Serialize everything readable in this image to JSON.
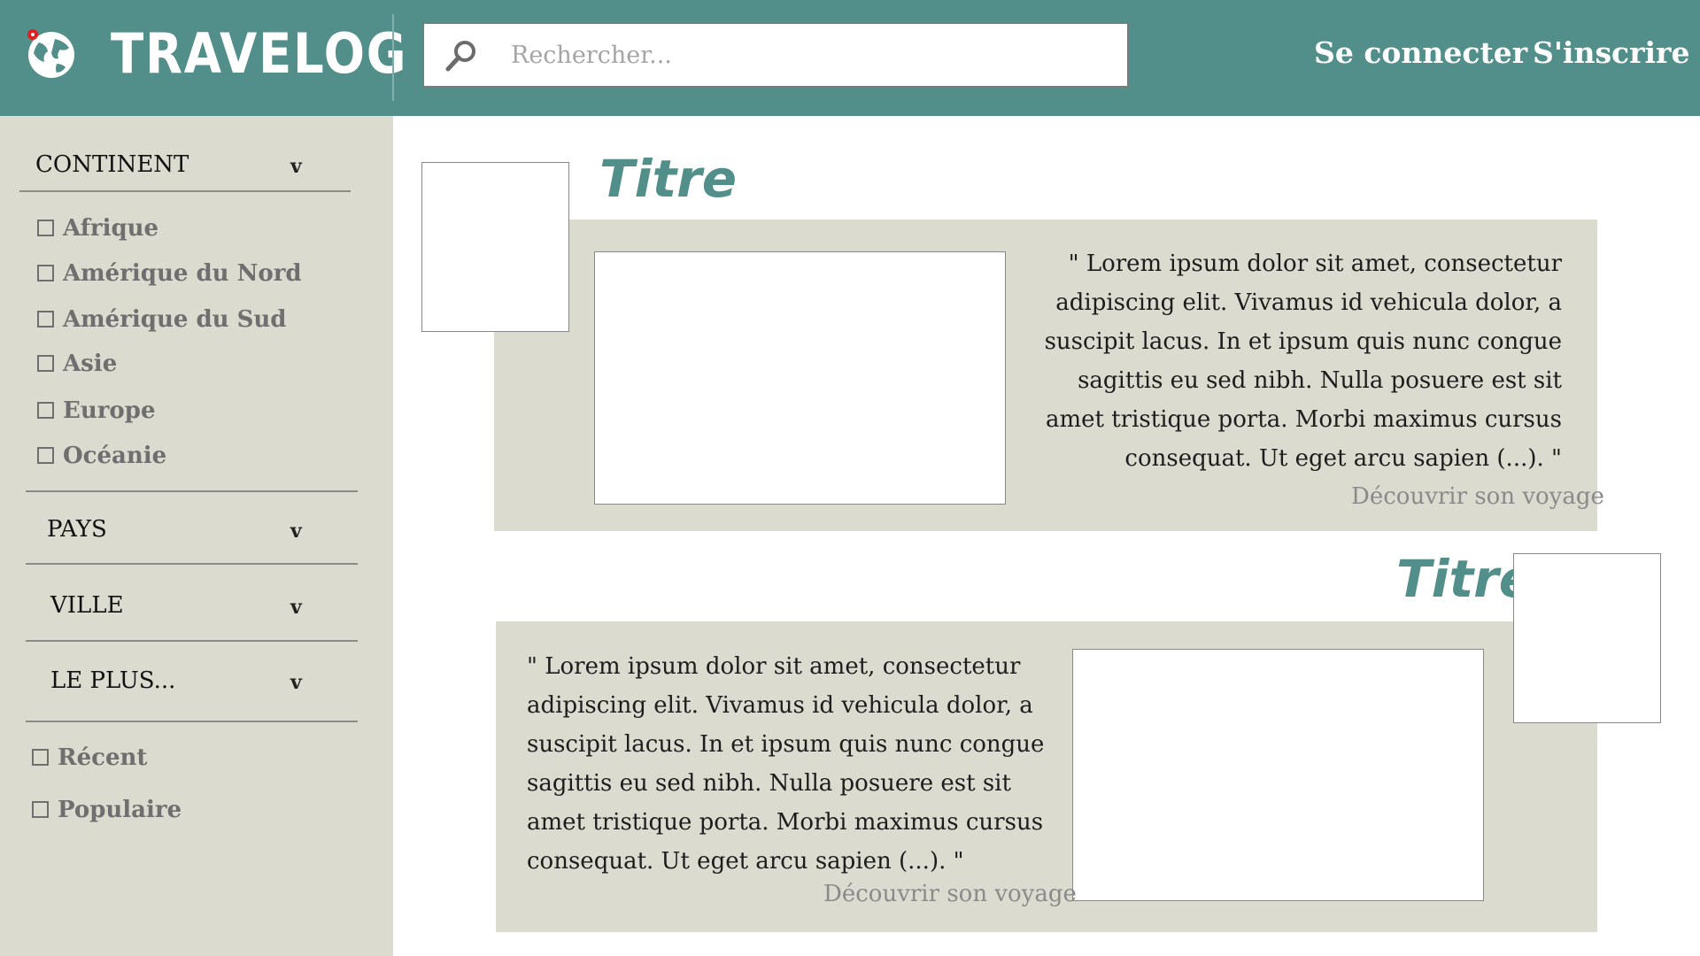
{
  "header": {
    "brand": "TRAVELOG",
    "search_placeholder": "Rechercher...",
    "login_label": "Se connecter",
    "signup_label": "S'inscrire",
    "colors": {
      "bar": "#538f8a",
      "text": "#ffffff",
      "pin": "#e02020"
    },
    "icons": {
      "logo": "globe-pin-icon",
      "search": "magnifier-icon"
    }
  },
  "sidebar": {
    "continent": {
      "label": "CONTINENT",
      "chevron": "v",
      "options": [
        "Afrique",
        "Amérique du Nord",
        "Amérique du Sud",
        "Asie",
        "Europe",
        "Océanie"
      ]
    },
    "pays": {
      "label": "PAYS",
      "chevron": "v"
    },
    "ville": {
      "label": "VILLE",
      "chevron": "v"
    },
    "le_plus": {
      "label": "LE PLUS...",
      "chevron": "v",
      "options": [
        "Récent",
        "Populaire"
      ]
    }
  },
  "cards": [
    {
      "title": "Titre",
      "text": "\" Lorem ipsum dolor sit amet, consectetur adipiscing elit. Vivamus id vehicula dolor, a suscipit lacus. In et ipsum quis nunc congue sagittis eu sed nibh. Nulla posuere est sit amet tristique porta. Morbi maximus cursus consequat. Ut eget arcu sapien (...). \"",
      "link": "Découvrir son voyage"
    },
    {
      "title": "Titre",
      "text": "\" Lorem ipsum dolor sit amet, consectetur adipiscing elit. Vivamus id vehicula dolor, a suscipit lacus. In et ipsum quis nunc congue sagittis eu sed nibh. Nulla posuere est sit amet tristique porta. Morbi maximus cursus consequat. Ut eget arcu sapien (...). \"",
      "link": "Découvrir son voyage"
    }
  ],
  "colors": {
    "sidebar_bg": "#dcdbcf",
    "card_bg": "#dcdbcf",
    "title": "#538f8a"
  }
}
